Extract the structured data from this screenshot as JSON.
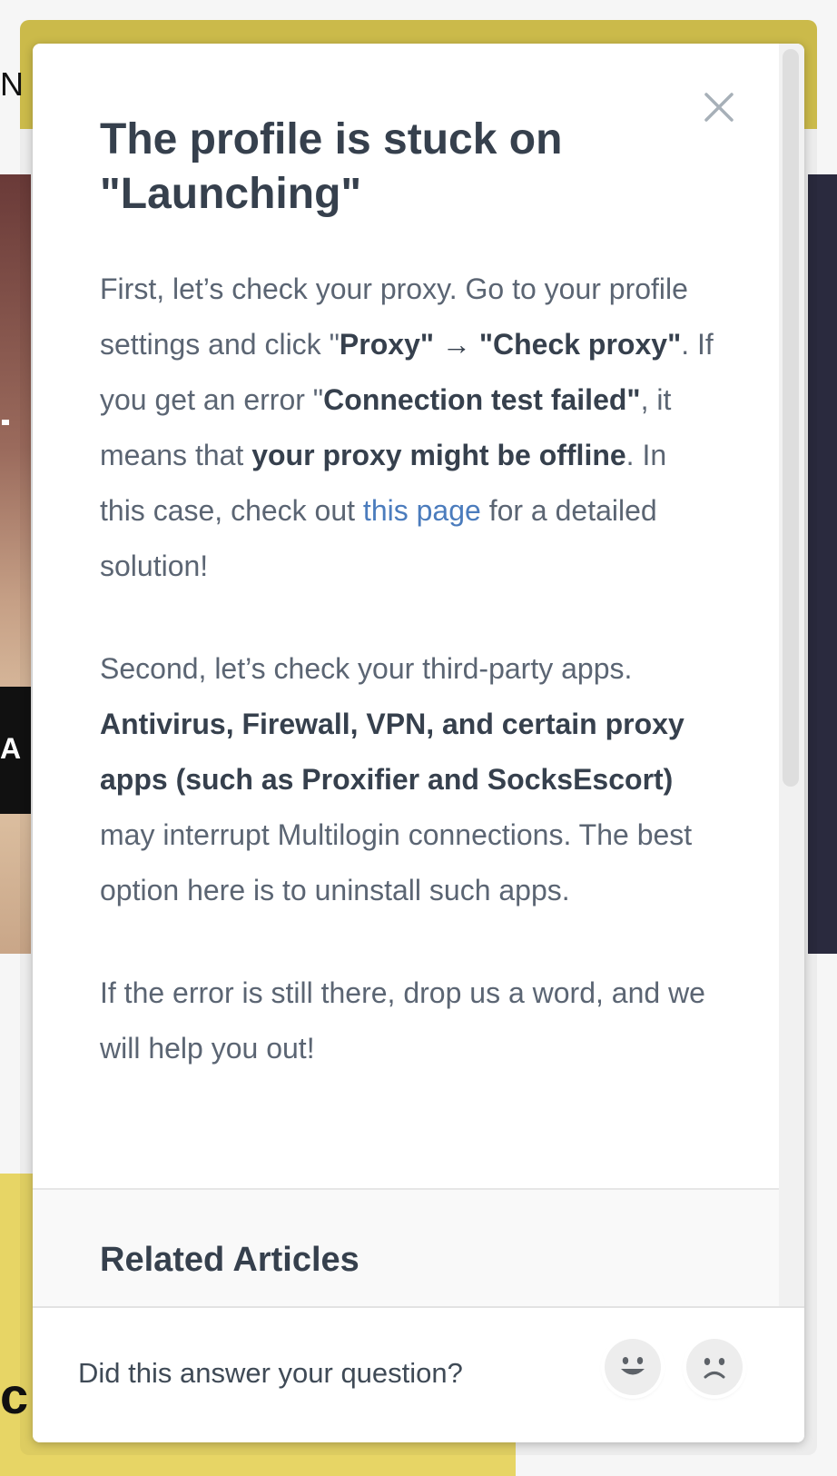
{
  "background": {
    "top_left_text": "N",
    "left_side_text": "A",
    "bottom_left_text": "c"
  },
  "article": {
    "title": "The profile is stuck on \"Launching\"",
    "p1": {
      "t1": "First, let’s check your proxy. Go to your profile settings and click \"",
      "b1": "Proxy\" → \"Check proxy\"",
      "t2": ". If you get an error \"",
      "b2": "Connection test failed\"",
      "t3": ", it means that ",
      "b3": "your proxy might be offline",
      "t4": ". In this case, check out ",
      "link": "this page",
      "t5": " for a detailed solution!"
    },
    "p2": {
      "t1": "Second, let’s check your third-party apps. ",
      "b1": "Antivirus, Firewall, VPN, and certain proxy apps (such as Proxifier and SocksEscort)",
      "t2": " may interrupt Multilogin connections. The best option here is to uninstall such apps."
    },
    "p3": "If the error is still there, drop us a word, and we will help you out!"
  },
  "related": {
    "title": "Related Articles"
  },
  "feedback": {
    "question": "Did this answer your question?",
    "reactions": [
      "smiley-icon",
      "disappointed-icon"
    ]
  },
  "icons": {
    "close": "close-icon"
  },
  "colors": {
    "link": "#4b7cbd",
    "heading": "#36404d",
    "body_text": "#5b6573",
    "banner_yellow": "#d4c24e"
  }
}
